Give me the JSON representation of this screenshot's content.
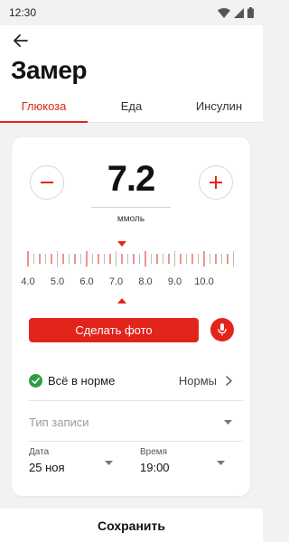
{
  "status": {
    "time": "12:30"
  },
  "header": {
    "title": "Замер"
  },
  "tabs": [
    {
      "label": "Глюкоза",
      "active": true
    },
    {
      "label": "Еда",
      "active": false
    },
    {
      "label": "Инсулин",
      "active": false
    }
  ],
  "measure": {
    "value": "7.2",
    "unit": "ммоль",
    "ruler_labels": [
      "4.0",
      "5.0",
      "6.0",
      "7.0",
      "8.0",
      "9.0",
      "10.0"
    ]
  },
  "actions": {
    "photo_label": "Сделать фото"
  },
  "norm": {
    "status_text": "Всё в норме",
    "link_label": "Нормы"
  },
  "record_type": {
    "placeholder": "Тип записи"
  },
  "date": {
    "label": "Дата",
    "value": "25 ноя"
  },
  "time": {
    "label": "Время",
    "value": "19:00"
  },
  "footer": {
    "save_label": "Сохранить"
  },
  "icons": [
    "back-arrow-icon",
    "minus-icon",
    "plus-icon",
    "mic-icon",
    "check-circle-icon",
    "chevron-right-icon",
    "dropdown-arrow-icon",
    "wifi-icon",
    "signal-icon",
    "battery-icon"
  ],
  "colors": {
    "accent": "#e3241b",
    "ok": "#2e9e45"
  }
}
